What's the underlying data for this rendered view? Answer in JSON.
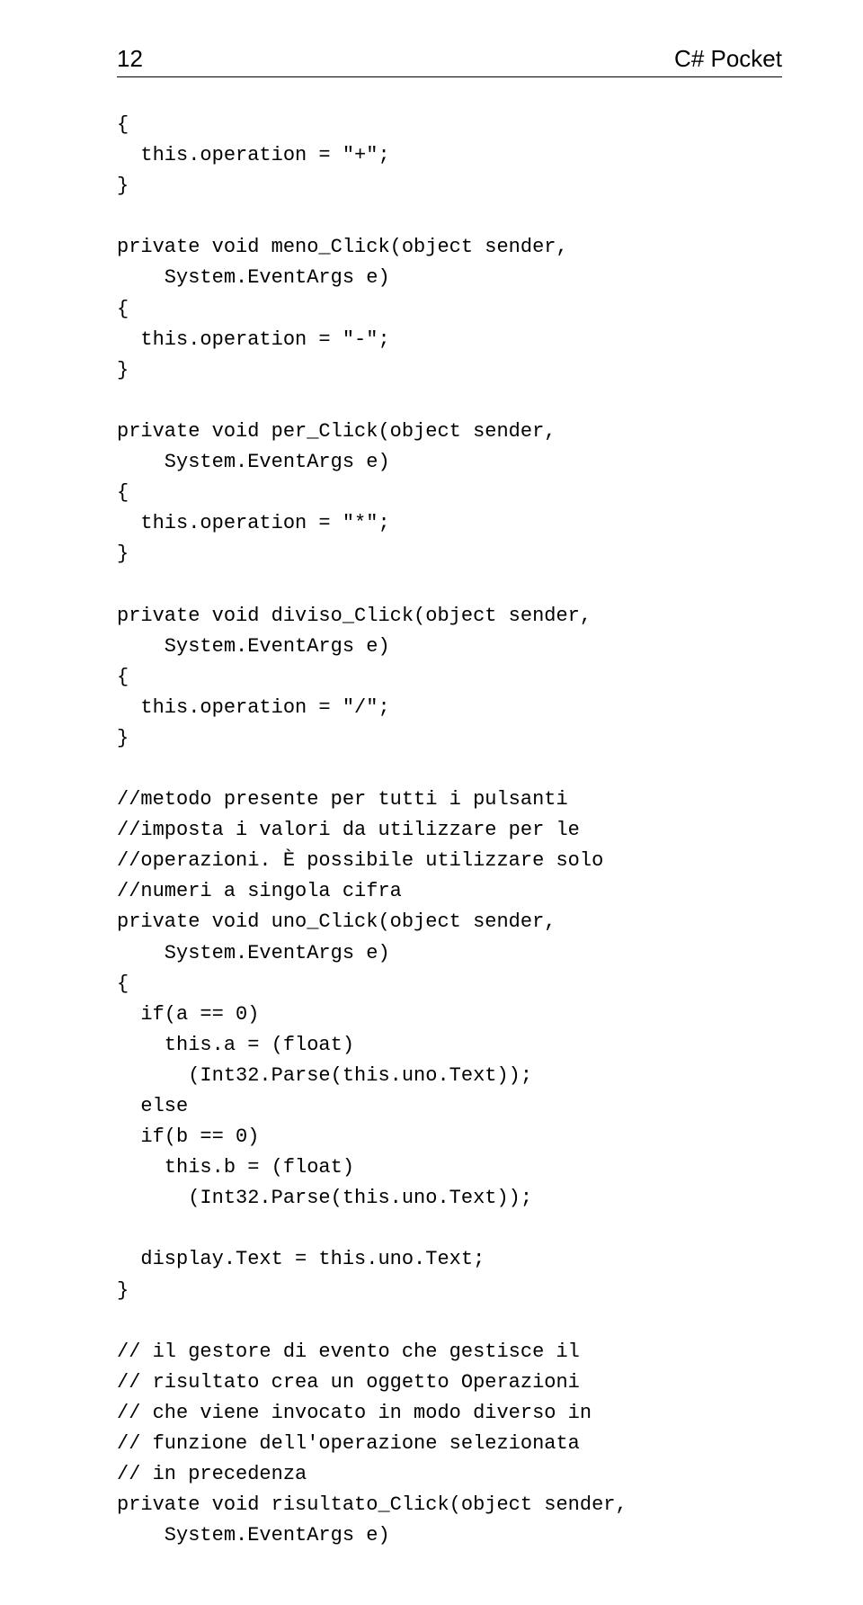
{
  "header": {
    "page_number": "12",
    "book_title": "C# Pocket"
  },
  "code": {
    "lines": [
      "{",
      "  this.operation = \"+\";",
      "}",
      "",
      "private void meno_Click(object sender,",
      "    System.EventArgs e)",
      "{",
      "  this.operation = \"-\";",
      "}",
      "",
      "private void per_Click(object sender,",
      "    System.EventArgs e)",
      "{",
      "  this.operation = \"*\";",
      "}",
      "",
      "private void diviso_Click(object sender,",
      "    System.EventArgs e)",
      "{",
      "  this.operation = \"/\";",
      "}",
      "",
      "//metodo presente per tutti i pulsanti",
      "//imposta i valori da utilizzare per le",
      "//operazioni. È possibile utilizzare solo",
      "//numeri a singola cifra",
      "private void uno_Click(object sender,",
      "    System.EventArgs e)",
      "{",
      "  if(a == 0)",
      "    this.a = (float)",
      "      (Int32.Parse(this.uno.Text));",
      "  else",
      "  if(b == 0)",
      "    this.b = (float)",
      "      (Int32.Parse(this.uno.Text));",
      "",
      "  display.Text = this.uno.Text;",
      "}",
      "",
      "// il gestore di evento che gestisce il",
      "// risultato crea un oggetto Operazioni",
      "// che viene invocato in modo diverso in",
      "// funzione dell'operazione selezionata",
      "// in precedenza",
      "private void risultato_Click(object sender,",
      "    System.EventArgs e)"
    ]
  }
}
